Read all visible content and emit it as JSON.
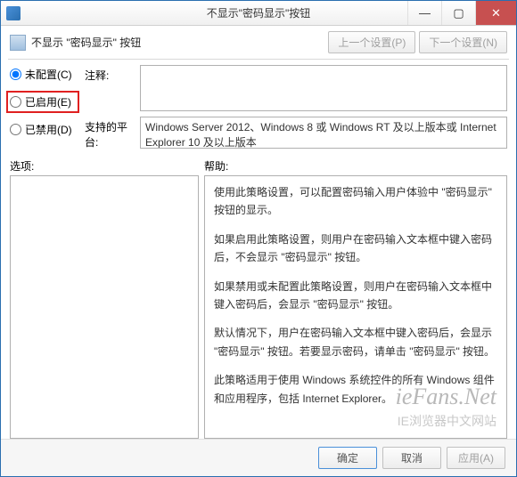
{
  "window": {
    "title": "不显示\"密码显示\"按钮"
  },
  "header": {
    "title": "不显示 \"密码显示\" 按钮",
    "prev_label": "上一个设置(P)",
    "next_label": "下一个设置(N)"
  },
  "radios": {
    "not_configured": "未配置(C)",
    "enabled": "已启用(E)",
    "disabled": "已禁用(D)",
    "selected": "not_configured"
  },
  "comment": {
    "label": "注释:"
  },
  "platform": {
    "label": "支持的平台:",
    "text": "Windows Server 2012、Windows 8 或 Windows RT 及以上版本或 Internet Explorer 10 及以上版本"
  },
  "panels": {
    "options_label": "选项:",
    "help_label": "帮助:"
  },
  "help": {
    "p1": "使用此策略设置，可以配置密码输入用户体验中 \"密码显示\" 按钮的显示。",
    "p2": "如果启用此策略设置，则用户在密码输入文本框中键入密码后，不会显示 \"密码显示\" 按钮。",
    "p3": "如果禁用或未配置此策略设置，则用户在密码输入文本框中键入密码后，会显示 \"密码显示\" 按钮。",
    "p4": "默认情况下，用户在密码输入文本框中键入密码后，会显示 \"密码显示\" 按钮。若要显示密码，请单击 \"密码显示\" 按钮。",
    "p5": "此策略适用于使用 Windows 系统控件的所有 Windows 组件和应用程序，包括 Internet Explorer。"
  },
  "watermark": {
    "line1": "ieFans.Net",
    "line2": "IE浏览器中文网站"
  },
  "footer": {
    "ok": "确定",
    "cancel": "取消",
    "apply": "应用(A)"
  }
}
